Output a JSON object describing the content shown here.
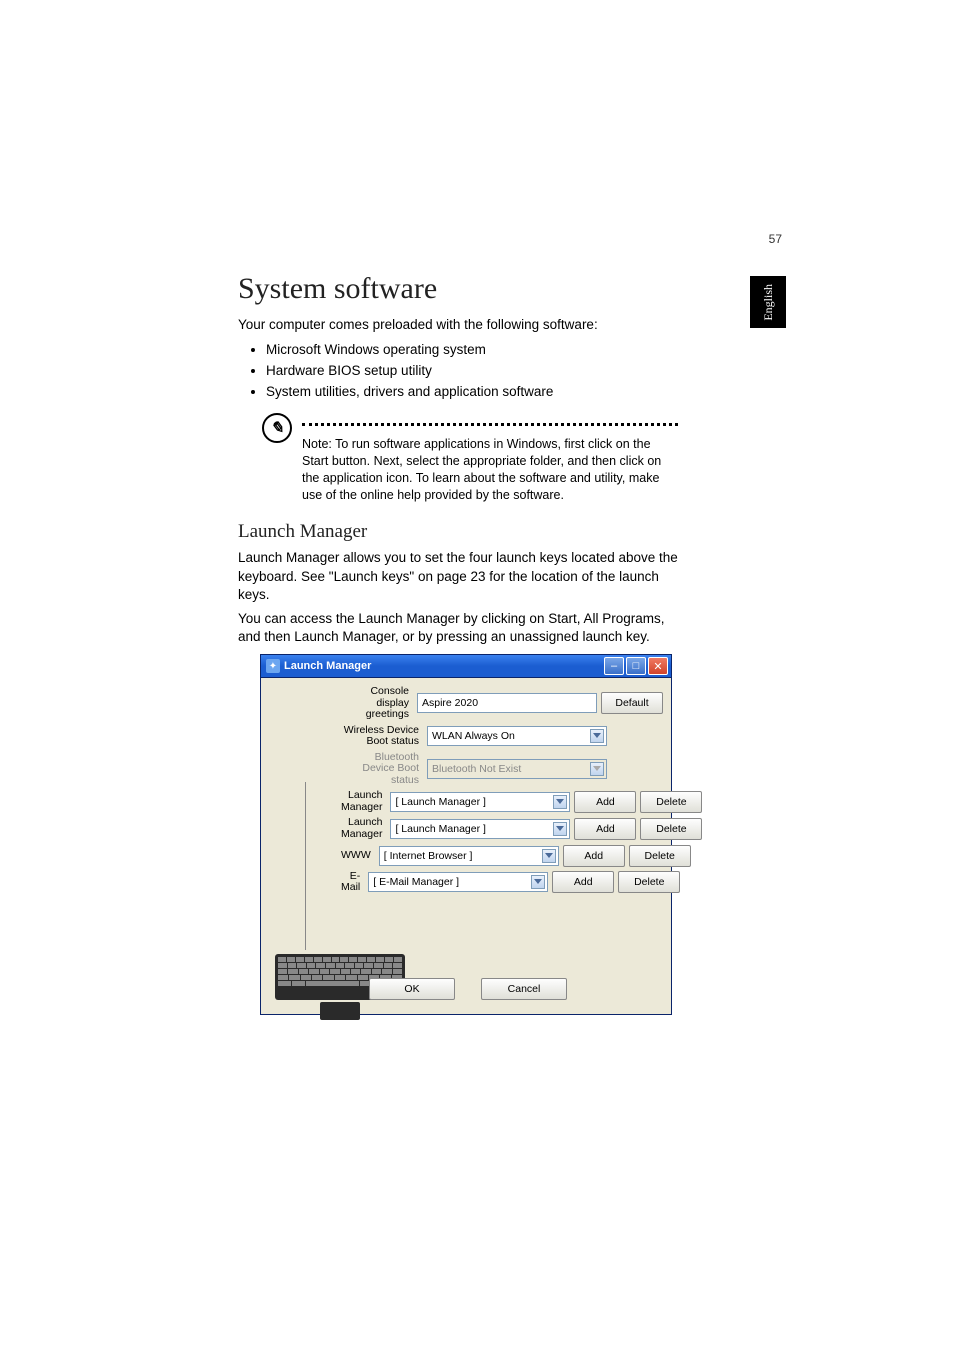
{
  "page_number": "57",
  "lang_tab": "English",
  "heading": "System software",
  "intro": "Your computer comes preloaded with the following software:",
  "bullets": [
    "Microsoft Windows operating system",
    "Hardware BIOS setup utility",
    "System utilities, drivers and application software"
  ],
  "note": "Note: To run software applications in Windows, first click on the Start button. Next, select the appropriate folder, and then click on the application icon. To learn about the software and utility, make use of the online help provided by the software.",
  "subheading": "Launch Manager",
  "sub_p1": "Launch Manager allows you to set the four launch keys located above the keyboard. See \"Launch keys\" on page 23 for the location of the launch keys.",
  "sub_p2": "You can access the Launch Manager by clicking on Start, All Programs, and then Launch Manager, or by pressing an unassigned launch key.",
  "window": {
    "title": "Launch Manager",
    "rows": {
      "greetings_label": "Console display greetings",
      "greetings_value": "Aspire 2020",
      "default_btn": "Default",
      "wlan_label": "Wireless Device Boot status",
      "wlan_value": "WLAN Always On",
      "bt_label": "Bluetooth Device Boot status",
      "bt_value": "Bluetooth Not Exist",
      "lm1_label": "Launch Manager",
      "lm1_value": "[  Launch Manager  ]",
      "lm2_label": "Launch Manager",
      "lm2_value": "[  Launch Manager  ]",
      "www_label": "WWW",
      "www_value": "[  Internet Browser  ]",
      "email_label": "E-Mail",
      "email_value": "[  E-Mail Manager  ]",
      "add_btn": "Add",
      "delete_btn": "Delete"
    },
    "ok_btn": "OK",
    "cancel_btn": "Cancel"
  }
}
